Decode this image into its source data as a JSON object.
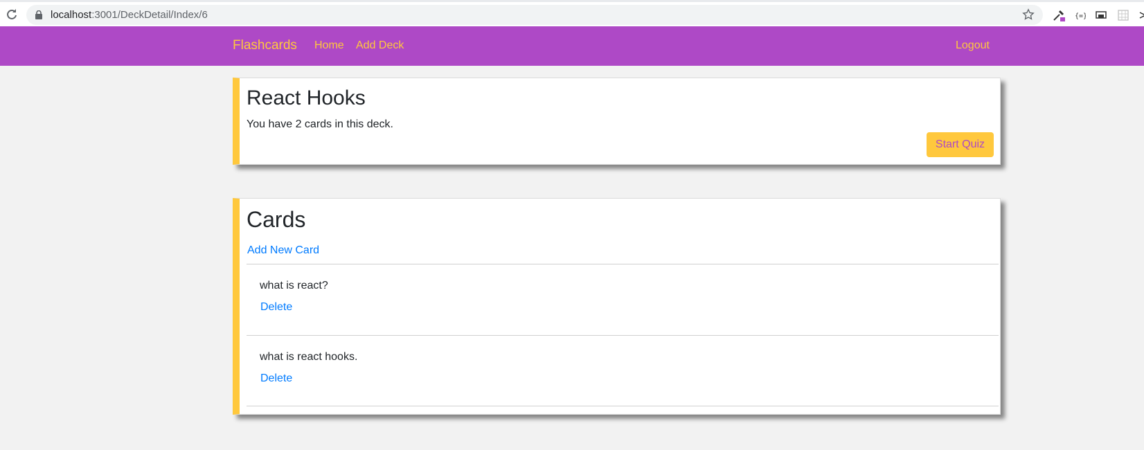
{
  "browser": {
    "url_host": "localhost",
    "url_path": ":3001/DeckDetail/Index/6"
  },
  "navbar": {
    "brand": "Flashcards",
    "links": [
      "Home",
      "Add Deck"
    ],
    "logout": "Logout",
    "bg_color": "#ae49c6",
    "accent_color": "#ffc83d"
  },
  "deck": {
    "title": "React Hooks",
    "count_text": "You have 2 cards in this deck.",
    "start_quiz": "Start Quiz"
  },
  "cards": {
    "title": "Cards",
    "add_new": "Add New Card",
    "items": [
      {
        "question": "what is react?",
        "delete": "Delete"
      },
      {
        "question": "what is react hooks.",
        "delete": "Delete"
      }
    ]
  }
}
